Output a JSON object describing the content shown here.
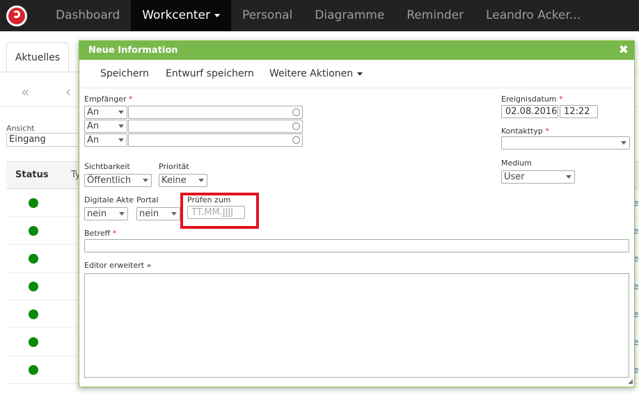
{
  "nav": {
    "items": [
      "Dashboard",
      "Workcenter",
      "Personal",
      "Diagramme",
      "Reminder",
      "Leandro Acker..."
    ]
  },
  "background": {
    "tab": "Aktuelles",
    "pager_first": "«",
    "pager_prev": "‹",
    "ansicht_label": "Ansicht",
    "ansicht_value": "Eingang",
    "col_status": "Status",
    "col_type": "Ty",
    "row_count": 7,
    "status_color": "#0a8a0a"
  },
  "modal": {
    "title": "Neue Information",
    "close": "✖",
    "toolbar": {
      "save": "Speichern",
      "save_draft": "Entwurf speichern",
      "more": "Weitere Aktionen"
    },
    "recipients_label": "Empfänger",
    "recipients": [
      "An",
      "An",
      "An"
    ],
    "event_date_label": "Ereignisdatum",
    "event_date": "02.08.2016",
    "event_time": "12:22",
    "contact_type_label": "Kontakttyp",
    "contact_type": "",
    "medium_label": "Medium",
    "medium": "User",
    "visibility_label": "Sichtbarkeit",
    "visibility": "Öffentlich",
    "priority_label": "Priorität",
    "priority": "Keine",
    "digital_file_label": "Digitale Akte",
    "digital_file": "nein",
    "portal_label": "Portal",
    "portal": "nein",
    "check_by_label": "Prüfen zum",
    "check_by_placeholder": "TT.MM.JJJJ",
    "subject_label": "Betreff",
    "subject": "",
    "editor_label": "Editor erweitert",
    "required_mark": "*",
    "highlight_color": "#e0141e",
    "header_color": "#79b84b"
  }
}
